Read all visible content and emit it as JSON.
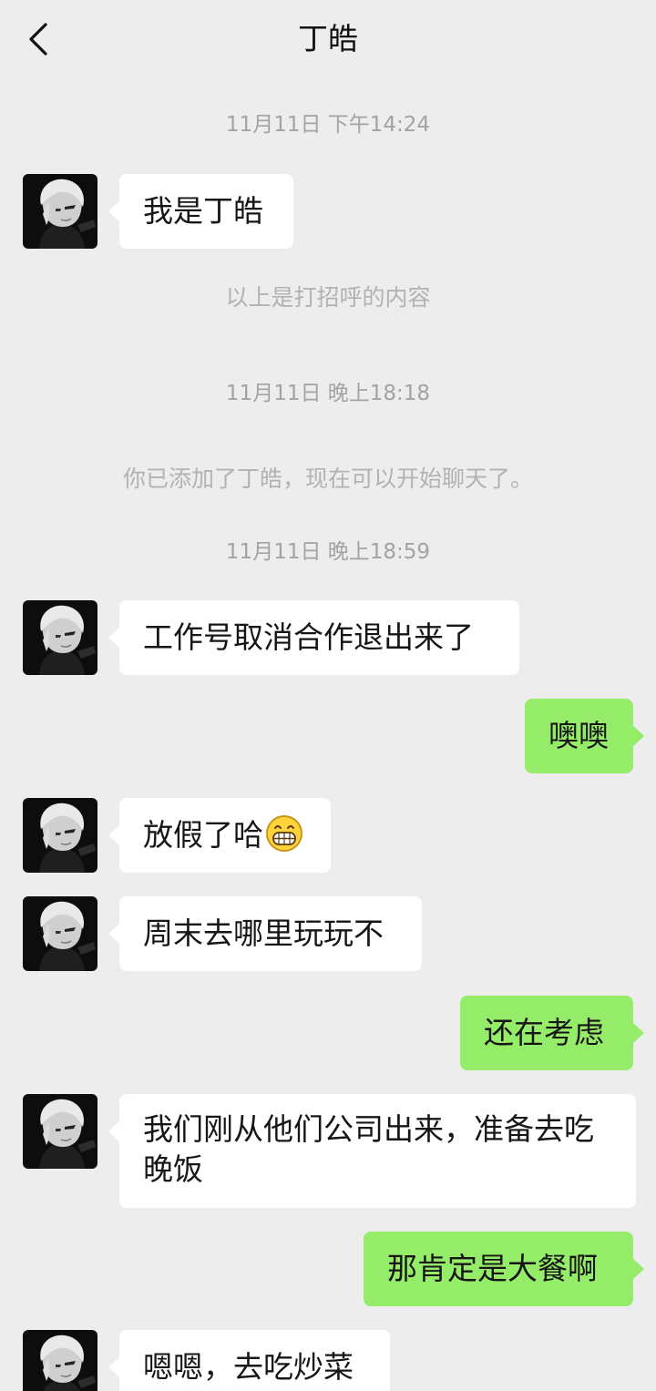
{
  "header": {
    "back_icon": "chevron-left-icon",
    "title": "丁皓"
  },
  "chat": {
    "time_1": "11月11日 下午14:24",
    "msg_1": "我是丁皓",
    "system_1": "以上是打招呼的内容",
    "time_2": "11月11日 晚上18:18",
    "system_2": "你已添加了丁皓，现在可以开始聊天了。",
    "time_3": "11月11日 晚上18:59",
    "msg_2": "工作号取消合作退出来了",
    "msg_3": "噢噢",
    "msg_4": "放假了哈",
    "msg_4_emoji": "grin-emoji",
    "msg_5": "周末去哪里玩玩不",
    "msg_6": "还在考虑",
    "msg_7_line1": "我们刚从他们公司出来，准备去吃",
    "msg_7_line2": "晚饭",
    "msg_8": "那肯定是大餐啊",
    "msg_9": "嗯嗯，去吃炒菜"
  },
  "colors": {
    "background": "#ededed",
    "incoming_bubble": "#ffffff",
    "outgoing_bubble": "#95ec69",
    "timestamp_text": "#a3a3a3"
  }
}
